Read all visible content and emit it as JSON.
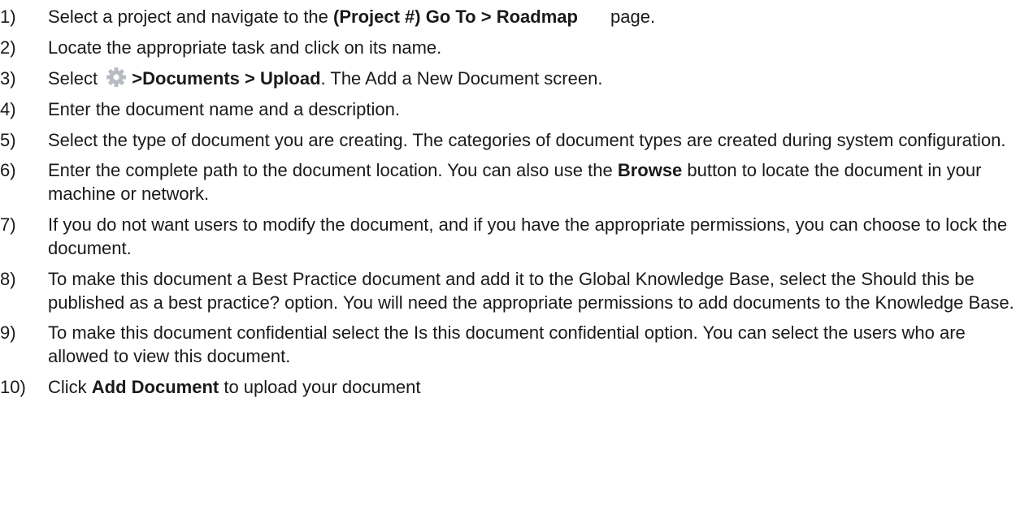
{
  "steps": [
    {
      "num": "1)",
      "before": "Select a project and navigate to the ",
      "bold": "(Project #) Go To > Roadmap",
      "after": " page."
    },
    {
      "num": "2)",
      "text": "Locate the appropriate task and click on its name."
    },
    {
      "num": "3)",
      "before": "Select ",
      "icon": "gear-icon",
      "bold": ">Documents > Upload",
      "after": ". The Add a New Document screen."
    },
    {
      "num": "4)",
      "text": "Enter the document name and a description."
    },
    {
      "num": "5)",
      "text": "Select the type of document you are creating. The categories of document types are created during system configuration."
    },
    {
      "num": "6)",
      "before": "Enter the complete path to the document location. You can also use the ",
      "bold": "Browse",
      "after": " button to locate the document in your machine or network."
    },
    {
      "num": "7)",
      "text": "If you do not want users to modify the document, and if you have the appropriate permissions, you can choose to lock the document."
    },
    {
      "num": "8)",
      "text": "To make this document a Best Practice document and add it to the Global Knowledge Base, select the Should this be published as a best practice? option. You will need the appropriate permissions to add documents to the Knowledge Base."
    },
    {
      "num": "9)",
      "text": "To make this document confidential select the Is this document confidential option. You can select the users who are allowed to view this document."
    },
    {
      "num": "10)",
      "before": "Click ",
      "bold": "Add Document",
      "after": " to upload your document"
    }
  ],
  "colors": {
    "text": "#1a1a1a",
    "gear_icon": "#b8bcc2"
  }
}
